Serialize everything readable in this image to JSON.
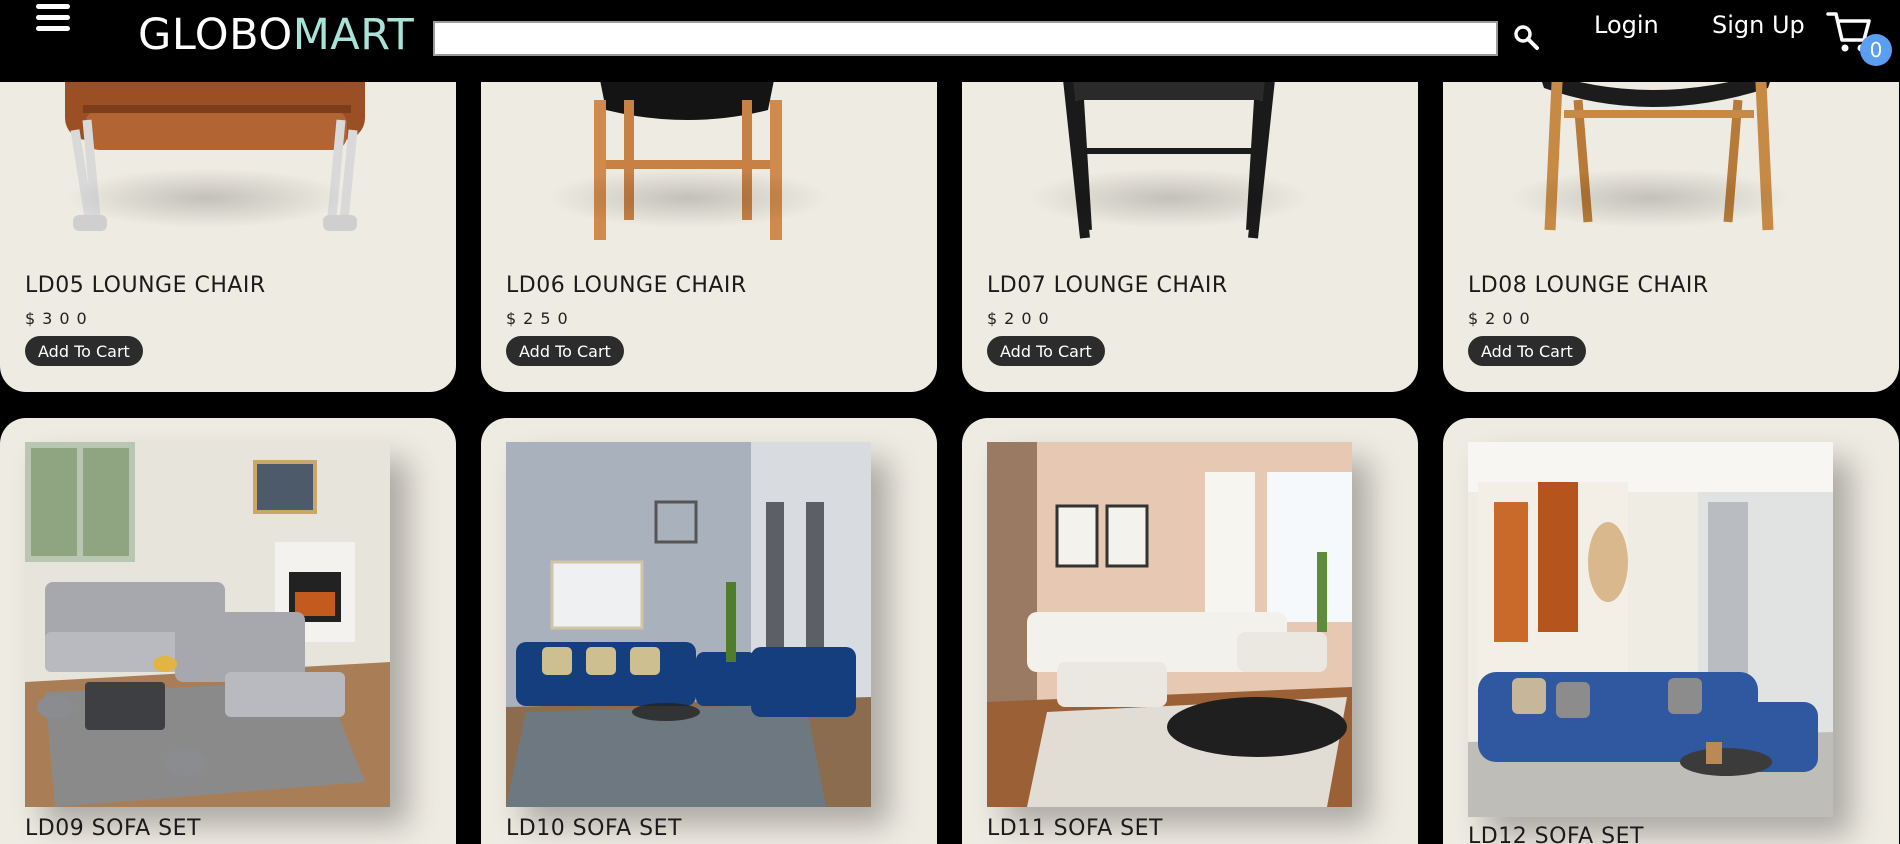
{
  "header": {
    "menu_icon": "hamburger-menu-icon",
    "brand_part1": "GLOBO",
    "brand_part2": "MART",
    "search_placeholder": "",
    "search_icon": "search-icon",
    "login_label": "Login",
    "signup_label": "Sign Up",
    "cart_icon": "shopping-cart-icon",
    "cart_count": "0"
  },
  "colors": {
    "brand_accent": "#a9e2d7",
    "card_background": "#eeebe2",
    "button_background": "#2c2c2c",
    "cart_badge": "#5a9ef0"
  },
  "products": [
    {
      "name": "LD05 LOUNGE CHAIR",
      "price": "$300",
      "button": "Add To Cart",
      "image": "brown-leather-lounge-chair"
    },
    {
      "name": "LD06 LOUNGE CHAIR",
      "price": "$250",
      "button": "Add To Cart",
      "image": "black-seat-wooden-chair"
    },
    {
      "name": "LD07 LOUNGE CHAIR",
      "price": "$200",
      "button": "Add To Cart",
      "image": "black-woven-chair"
    },
    {
      "name": "LD08 LOUNGE CHAIR",
      "price": "$200",
      "button": "Add To Cart",
      "image": "oak-lounge-chair"
    },
    {
      "name": "LD09 SOFA SET",
      "image": "grey-sectional-sofa-living-room"
    },
    {
      "name": "LD10 SOFA SET",
      "image": "blue-velvet-sofa-set"
    },
    {
      "name": "LD11 SOFA SET",
      "image": "white-sectional-sofa"
    },
    {
      "name": "LD12 SOFA SET",
      "image": "blue-corner-sofa"
    }
  ]
}
